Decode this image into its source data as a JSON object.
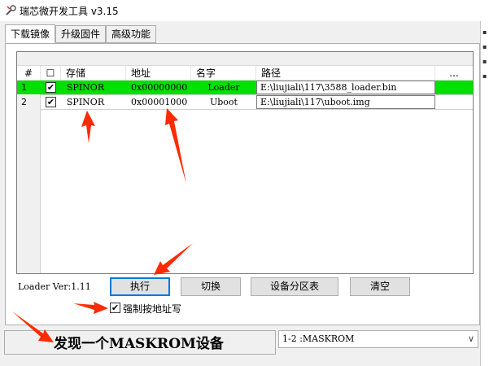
{
  "window": {
    "title": "瑞芯微开发工具 v3.15",
    "app_icon": "wrench-icon"
  },
  "tabs": [
    {
      "label": "下载镜像",
      "active": true
    },
    {
      "label": "升级固件",
      "active": false
    },
    {
      "label": "高级功能",
      "active": false
    }
  ],
  "table": {
    "columns": [
      "#",
      "☐",
      "存储",
      "地址",
      "名字",
      "路径",
      "..."
    ],
    "rows": [
      {
        "index": "1",
        "checked": true,
        "storage": "SPINOR",
        "address": "0x00000000",
        "name": "Loader",
        "path": "E:\\liujiali\\117\\3588_loader.bin",
        "highlighted": true
      },
      {
        "index": "2",
        "checked": true,
        "storage": "SPINOR",
        "address": "0x00001000",
        "name": "Uboot",
        "path": "E:\\liujiali\\117\\uboot.img",
        "highlighted": false
      }
    ]
  },
  "loader_version": "Loader Ver:1.11",
  "buttons": {
    "execute": "执行",
    "switch": "切换",
    "device_partition": "设备分区表",
    "clear": "清空"
  },
  "force_address": {
    "label": "强制按地址写",
    "checked": true
  },
  "status": {
    "message": "发现一个MASKROM设备",
    "device": "1-2 :MASKROM"
  },
  "colors": {
    "highlight_row": "#00e000",
    "annotation_arrow": "#ff2a00",
    "primary_button_border": "#0078d7"
  },
  "annotations": [
    "red-arrow-storage",
    "red-arrow-address",
    "red-arrow-execute",
    "red-arrow-force-write",
    "red-arrow-status"
  ]
}
